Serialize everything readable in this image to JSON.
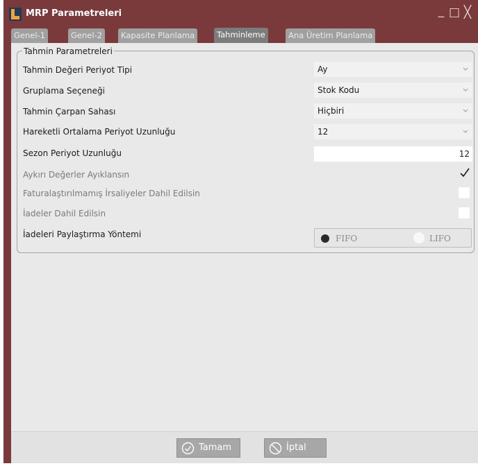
{
  "window": {
    "title": "MRP Parametreleri",
    "controls": [
      "minimize",
      "maximize",
      "close"
    ]
  },
  "tabs": [
    {
      "label": "Genel-1",
      "active": false
    },
    {
      "label": "Genel-2",
      "active": false
    },
    {
      "label": "Kapasite Planlama",
      "active": false
    },
    {
      "label": "Tahminleme",
      "active": true
    },
    {
      "label": "Ana Üretim Planlama",
      "active": false
    }
  ],
  "group": {
    "title": "Tahmin Parametreleri",
    "fields": {
      "period_type": {
        "label": "Tahmin Değeri Periyot Tipi",
        "value": "Ay"
      },
      "grouping": {
        "label": "Gruplama Seçeneği",
        "value": "Stok Kodu"
      },
      "multiplier": {
        "label": "Tahmin Çarpan Sahası",
        "value": "Hiçbiri"
      },
      "moving_avg": {
        "label": "Hareketli Ortalama Periyot Uzunluğu",
        "value": "12"
      },
      "season": {
        "label": "Sezon Periyot Uzunluğu",
        "value": "12"
      },
      "outliers": {
        "label": "Aykırı Değerler Ayıklansın",
        "checked": true
      },
      "uninvoiced": {
        "label": "Faturalaştırılmamış İrsaliyeler Dahil Edilsin",
        "checked": false
      },
      "returns": {
        "label": "İadeler Dahil Edilsin",
        "checked": false
      },
      "return_method": {
        "label": "İadeleri Paylaştırma Yöntemi",
        "options": [
          "FIFO",
          "LIFO"
        ],
        "selected": "FIFO"
      }
    }
  },
  "footer": {
    "ok_label": "Tamam",
    "cancel_label": "İptal"
  },
  "colors": {
    "title_bar": "#7a3a3c",
    "active_tab": "#7c7c7c",
    "inactive_tab": "#a0a0a0",
    "panel": "#e9e9e9",
    "button": "#a7a7a7"
  },
  "icons": {
    "app": "logo-icon",
    "dropdown": "chevron-down-icon",
    "check": "checkmark-icon",
    "ok": "check-circle-icon",
    "cancel": "prohibited-icon"
  }
}
